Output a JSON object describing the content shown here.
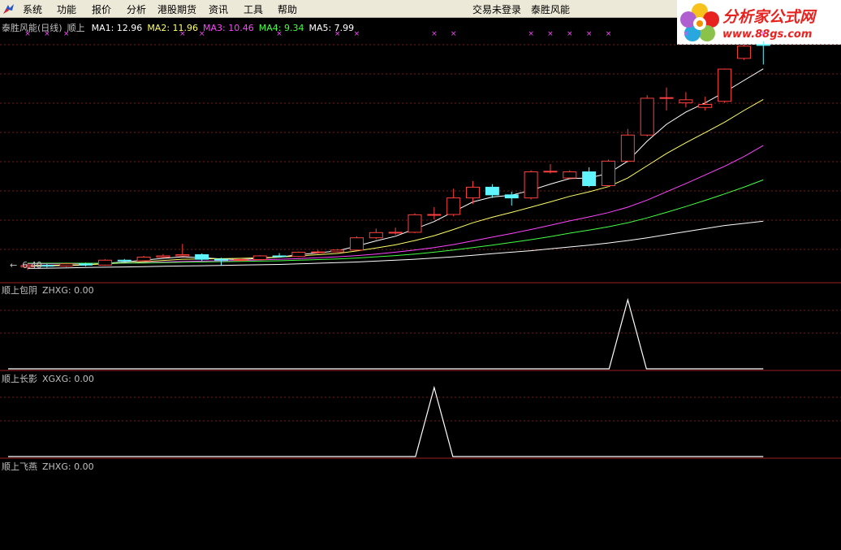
{
  "menu": {
    "items": [
      "系统",
      "功能",
      "报价",
      "分析",
      "港股期货",
      "资讯",
      "工具",
      "帮助"
    ]
  },
  "status": {
    "login": "交易未登录",
    "stock_name": "泰胜风能"
  },
  "logo": {
    "title": "分析家公式网",
    "url": "www.88gs.com"
  },
  "main_panel": {
    "name": "泰胜风能(日线)",
    "indicator": "顺上",
    "ma": [
      {
        "label": "MA1: 12.96",
        "color": "#ffffff"
      },
      {
        "label": "MA2: 11.96",
        "color": "#ffff66"
      },
      {
        "label": "MA3: 10.46",
        "color": "#ff44ff"
      },
      {
        "label": "MA4: 9.34",
        "color": "#44ff44"
      },
      {
        "label": "MA5: 7.99",
        "color": "#ffffff"
      }
    ],
    "low_label": "6.40"
  },
  "sub_panels": [
    {
      "name": "顺上包阴",
      "value": "ZHXG: 0.00"
    },
    {
      "name": "顺上长影",
      "value": "XGXG: 0.00"
    },
    {
      "name": "顺上飞燕",
      "value": "ZHXG: 0.00"
    }
  ],
  "chart_data": {
    "type": "candlestick",
    "title": "泰胜风能(日线)",
    "candles": [
      {
        "o": 6.5,
        "c": 6.55,
        "h": 6.62,
        "l": 6.4
      },
      {
        "o": 6.55,
        "c": 6.53,
        "h": 6.6,
        "l": 6.48
      },
      {
        "o": 6.53,
        "c": 6.6,
        "h": 6.65,
        "l": 6.5
      },
      {
        "o": 6.6,
        "c": 6.56,
        "h": 6.64,
        "l": 6.52
      },
      {
        "o": 6.56,
        "c": 6.72,
        "h": 6.75,
        "l": 6.54
      },
      {
        "o": 6.72,
        "c": 6.7,
        "h": 6.76,
        "l": 6.66
      },
      {
        "o": 6.7,
        "c": 6.82,
        "h": 6.86,
        "l": 6.68
      },
      {
        "o": 6.82,
        "c": 6.86,
        "h": 6.92,
        "l": 6.8
      },
      {
        "o": 6.86,
        "c": 6.9,
        "h": 7.25,
        "l": 6.84
      },
      {
        "o": 6.9,
        "c": 6.75,
        "h": 6.94,
        "l": 6.7
      },
      {
        "o": 6.75,
        "c": 6.72,
        "h": 6.8,
        "l": 6.55
      },
      {
        "o": 6.72,
        "c": 6.74,
        "h": 6.78,
        "l": 6.68
      },
      {
        "o": 6.74,
        "c": 6.86,
        "h": 6.88,
        "l": 6.72
      },
      {
        "o": 6.86,
        "c": 6.84,
        "h": 6.95,
        "l": 6.8
      },
      {
        "o": 6.84,
        "c": 6.98,
        "h": 7.0,
        "l": 6.82
      },
      {
        "o": 6.98,
        "c": 6.99,
        "h": 7.05,
        "l": 6.93
      },
      {
        "o": 6.99,
        "c": 7.05,
        "h": 7.08,
        "l": 6.97
      },
      {
        "o": 7.05,
        "c": 7.45,
        "h": 7.5,
        "l": 7.03
      },
      {
        "o": 7.45,
        "c": 7.62,
        "h": 7.75,
        "l": 7.4
      },
      {
        "o": 7.62,
        "c": 7.63,
        "h": 7.78,
        "l": 7.55
      },
      {
        "o": 7.63,
        "c": 8.2,
        "h": 8.25,
        "l": 7.6
      },
      {
        "o": 8.2,
        "c": 8.21,
        "h": 8.45,
        "l": 8.05
      },
      {
        "o": 8.21,
        "c": 8.75,
        "h": 9.05,
        "l": 8.15
      },
      {
        "o": 8.75,
        "c": 9.1,
        "h": 9.3,
        "l": 8.55
      },
      {
        "o": 9.1,
        "c": 8.85,
        "h": 9.2,
        "l": 8.75
      },
      {
        "o": 8.85,
        "c": 8.75,
        "h": 8.95,
        "l": 8.5
      },
      {
        "o": 8.75,
        "c": 9.6,
        "h": 9.65,
        "l": 8.7
      },
      {
        "o": 9.6,
        "c": 9.62,
        "h": 9.85,
        "l": 9.55
      },
      {
        "o": 9.4,
        "c": 9.6,
        "h": 9.65,
        "l": 9.35
      },
      {
        "o": 9.6,
        "c": 9.15,
        "h": 9.75,
        "l": 9.1
      },
      {
        "o": 9.15,
        "c": 9.95,
        "h": 10.0,
        "l": 9.1
      },
      {
        "o": 9.95,
        "c": 10.8,
        "h": 11.0,
        "l": 9.9
      },
      {
        "o": 10.8,
        "c": 12.0,
        "h": 12.1,
        "l": 10.75
      },
      {
        "o": 12.0,
        "c": 12.02,
        "h": 12.35,
        "l": 11.6
      },
      {
        "o": 11.85,
        "c": 11.95,
        "h": 12.2,
        "l": 11.7
      },
      {
        "o": 11.7,
        "c": 11.8,
        "h": 12.05,
        "l": 11.6
      },
      {
        "o": 11.9,
        "c": 12.95,
        "h": 12.97,
        "l": 11.85
      },
      {
        "o": 13.3,
        "c": 13.7,
        "h": 13.75,
        "l": 13.25
      },
      {
        "o": 13.75,
        "c": 13.74,
        "h": 13.86,
        "l": 13.1
      }
    ],
    "ma_series": [
      {
        "name": "MA1",
        "color": "#ffffff",
        "values": [
          6.52,
          6.53,
          6.55,
          6.56,
          6.62,
          6.66,
          6.72,
          6.78,
          6.83,
          6.8,
          6.76,
          6.74,
          6.78,
          6.82,
          6.9,
          6.96,
          7.02,
          7.18,
          7.35,
          7.5,
          7.74,
          7.98,
          8.3,
          8.62,
          8.78,
          8.84,
          9.0,
          9.2,
          9.38,
          9.4,
          9.55,
          9.95,
          10.6,
          11.15,
          11.55,
          11.85,
          12.2,
          12.58,
          12.96
        ]
      },
      {
        "name": "MA2",
        "color": "#ffff66",
        "values": [
          6.55,
          6.55,
          6.56,
          6.57,
          6.6,
          6.63,
          6.67,
          6.71,
          6.75,
          6.76,
          6.77,
          6.78,
          6.8,
          6.82,
          6.86,
          6.9,
          6.94,
          7.02,
          7.12,
          7.22,
          7.36,
          7.52,
          7.72,
          7.94,
          8.12,
          8.28,
          8.45,
          8.62,
          8.8,
          8.95,
          9.12,
          9.4,
          9.8,
          10.2,
          10.55,
          10.88,
          11.22,
          11.6,
          11.96
        ]
      },
      {
        "name": "MA3",
        "color": "#ff44ff",
        "values": [
          6.6,
          6.6,
          6.6,
          6.61,
          6.62,
          6.63,
          6.64,
          6.66,
          6.68,
          6.69,
          6.7,
          6.71,
          6.73,
          6.75,
          6.77,
          6.8,
          6.83,
          6.87,
          6.92,
          6.98,
          7.05,
          7.13,
          7.23,
          7.35,
          7.47,
          7.59,
          7.72,
          7.86,
          8.0,
          8.13,
          8.27,
          8.45,
          8.68,
          8.95,
          9.22,
          9.5,
          9.78,
          10.1,
          10.46
        ]
      },
      {
        "name": "MA4",
        "color": "#44ff44",
        "values": [
          6.62,
          6.62,
          6.62,
          6.62,
          6.62,
          6.63,
          6.63,
          6.64,
          6.65,
          6.66,
          6.67,
          6.68,
          6.69,
          6.7,
          6.72,
          6.74,
          6.76,
          6.79,
          6.83,
          6.87,
          6.92,
          6.98,
          7.05,
          7.13,
          7.21,
          7.3,
          7.39,
          7.49,
          7.6,
          7.7,
          7.81,
          7.94,
          8.1,
          8.28,
          8.47,
          8.67,
          8.88,
          9.1,
          9.34
        ]
      },
      {
        "name": "MA5",
        "color": "#ffffff",
        "values": [
          6.45,
          6.46,
          6.47,
          6.48,
          6.49,
          6.5,
          6.51,
          6.52,
          6.53,
          6.54,
          6.55,
          6.56,
          6.57,
          6.58,
          6.6,
          6.62,
          6.64,
          6.66,
          6.69,
          6.72,
          6.75,
          6.79,
          6.83,
          6.88,
          6.93,
          6.98,
          7.03,
          7.09,
          7.15,
          7.21,
          7.28,
          7.36,
          7.45,
          7.55,
          7.65,
          7.75,
          7.85,
          7.92,
          7.99
        ]
      }
    ],
    "ylim": [
      6.25,
      14.25
    ],
    "signal_marks_x": [
      0,
      1,
      2,
      8,
      9,
      13,
      16,
      17,
      21,
      22,
      26,
      27,
      28,
      29,
      30,
      34,
      38
    ],
    "sub_signals": [
      {
        "name": "ZHXG",
        "peak_index": 31,
        "values_note": "single spike"
      },
      {
        "name": "XGXG",
        "peak_index": 21,
        "values_note": "single spike"
      }
    ]
  }
}
